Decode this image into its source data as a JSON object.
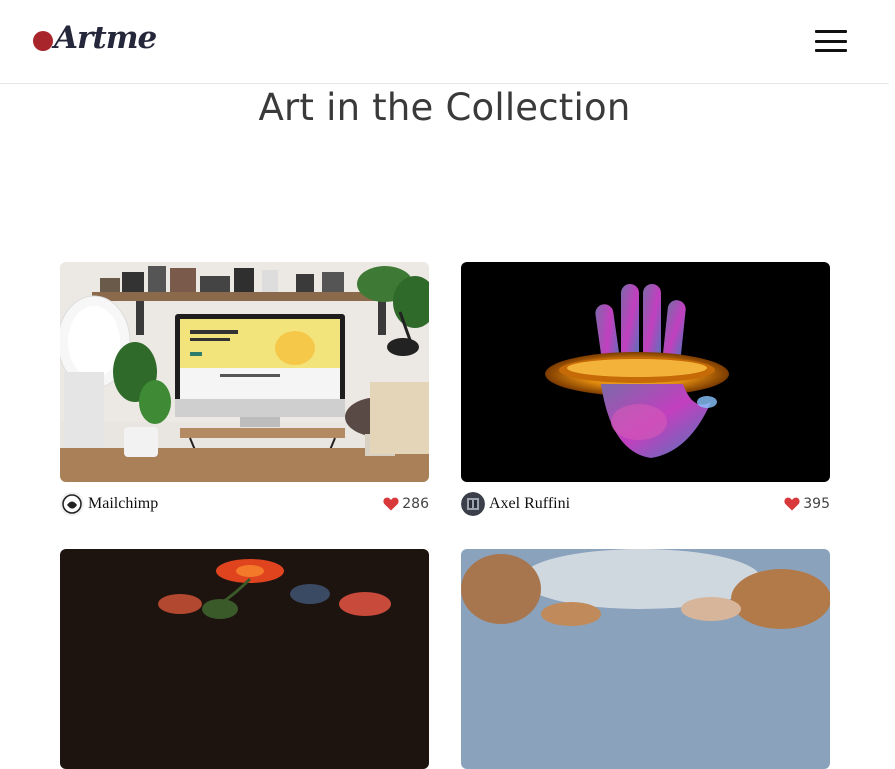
{
  "header": {
    "logo_text": "Artme",
    "menu_icon": "hamburger-menu-icon"
  },
  "page": {
    "title": "Art in the Collection"
  },
  "cards": [
    {
      "author": "Mailchimp",
      "likes": "286",
      "image": "desk-workspace-photo",
      "avatar": "mailchimp-avatar"
    },
    {
      "author": "Axel Ruffini",
      "likes": "395",
      "image": "glass-hand-3d-render",
      "avatar": "axel-ruffini-avatar"
    },
    {
      "image": "floral-still-life-painting"
    },
    {
      "image": "baroque-ceiling-fresco"
    }
  ],
  "colors": {
    "brand_dot": "#a8262b",
    "heart": "#d9383a",
    "text_dark": "#25273a"
  }
}
